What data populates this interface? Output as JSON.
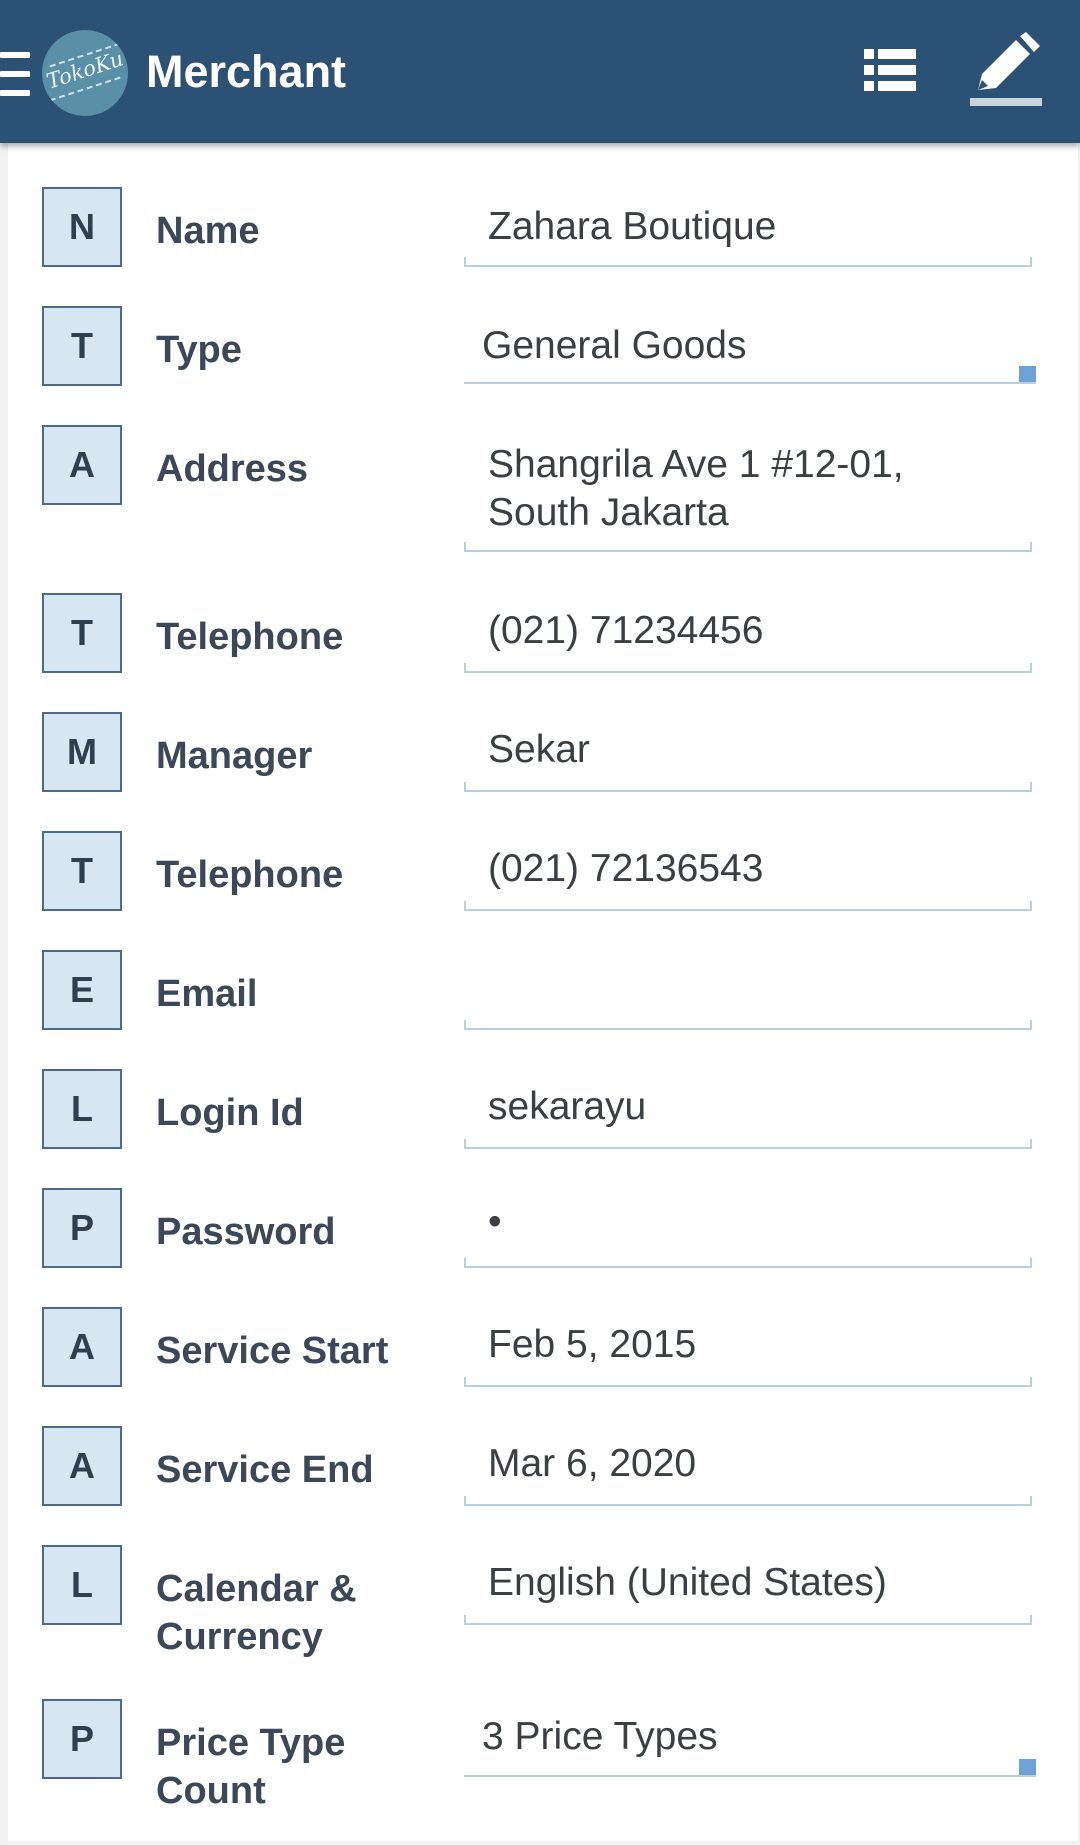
{
  "appbar": {
    "title": "Merchant",
    "logo_text": "TokoKu",
    "icons": [
      "menu-icon",
      "list-icon",
      "edit-icon"
    ]
  },
  "fields": [
    {
      "badge": "N",
      "label": "Name",
      "value": "Zahara Boutique"
    },
    {
      "badge": "T",
      "label": "Type",
      "value": "General Goods"
    },
    {
      "badge": "A",
      "label": "Address",
      "value": "Shangrila Ave 1 #12-01,\nSouth Jakarta"
    },
    {
      "badge": "T",
      "label": "Telephone",
      "value": "(021) 71234456"
    },
    {
      "badge": "M",
      "label": "Manager",
      "value": "Sekar"
    },
    {
      "badge": "T",
      "label": "Telephone",
      "value": "(021) 72136543"
    },
    {
      "badge": "E",
      "label": "Email",
      "value": ""
    },
    {
      "badge": "L",
      "label": "Login Id",
      "value": "sekarayu"
    },
    {
      "badge": "P",
      "label": "Password",
      "value": "•"
    },
    {
      "badge": "A",
      "label": "Service Start",
      "value": "Feb 5, 2015"
    },
    {
      "badge": "A",
      "label": "Service End",
      "value": "Mar 6, 2020"
    },
    {
      "badge": "L",
      "label": "Calendar & Currency",
      "value": "English (United States)"
    },
    {
      "badge": "P",
      "label": "Price Type Count",
      "value": "3 Price Types"
    }
  ],
  "colors": {
    "appbar": "#2b5275",
    "badge_bg": "#d8e6f2",
    "field_line": "#b9cfe0",
    "select_corner": "#6fa3d6"
  }
}
